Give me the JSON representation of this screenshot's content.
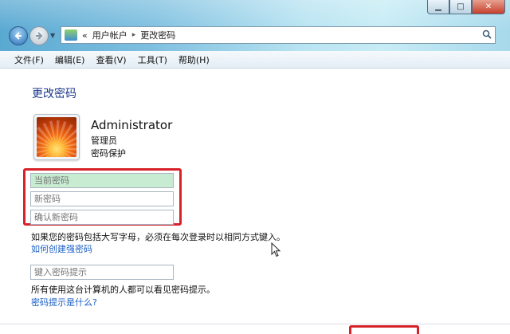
{
  "window": {
    "minimize_glyph": "▁",
    "maximize_glyph": "□",
    "close_glyph": "✕"
  },
  "address": {
    "prefix": "«",
    "crumbs": [
      "用户帐户",
      "更改密码"
    ],
    "separator": "▸"
  },
  "menu": [
    "文件(F)",
    "编辑(E)",
    "查看(V)",
    "工具(T)",
    "帮助(H)"
  ],
  "page": {
    "title": "更改密码",
    "user": {
      "name": "Administrator",
      "role": "管理员",
      "protection": "密码保护"
    },
    "fields": {
      "current_password_placeholder": "当前密码",
      "new_password_placeholder": "新密码",
      "confirm_password_placeholder": "确认新密码",
      "hint_placeholder": "键入密码提示"
    },
    "caps_note": "如果您的密码包括大写字母，必须在每次登录时以相同方式键入。",
    "strong_password_link": "如何创建强密码",
    "hint_note": "所有使用这台计算机的人都可以看见密码提示。",
    "hint_link": "密码提示是什么?"
  },
  "colors": {
    "highlight_border": "#d6232a",
    "link": "#1c5fc6",
    "title": "#1e3a8a",
    "active_field": "#c8ecd1"
  }
}
